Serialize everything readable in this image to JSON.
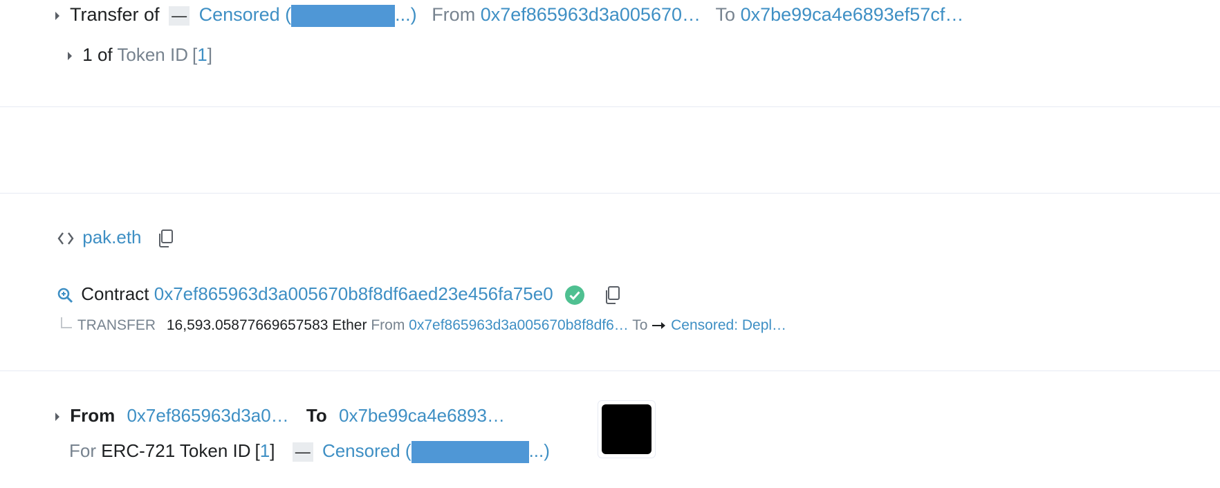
{
  "transfer_row": {
    "prefix": "Transfer of",
    "dash": "—",
    "token_name": "Censored (",
    "token_suffix": "...)",
    "from_label": "From",
    "from_addr": "0x7ef865963d3a005670…",
    "to_label": "To",
    "to_addr": "0x7be99ca4e6893ef57cf…"
  },
  "token_id_row": {
    "count": "1",
    "of_label": "of",
    "token_id_label": "Token ID",
    "bracket_open": "[",
    "token_id": "1",
    "bracket_close": "]"
  },
  "ens": {
    "name": "pak.eth"
  },
  "contract": {
    "label": "Contract",
    "address": "0x7ef865963d3a005670b8f8df6aed23e456fa75e0"
  },
  "internal_transfer": {
    "type": "TRANSFER",
    "amount": "16,593.05877669657583 Ether",
    "from_label": "From",
    "from_addr": "0x7ef865963d3a005670b8f8df6…",
    "to_label": "To",
    "to_addr": "Censored: Depl…"
  },
  "nft_transfer": {
    "from_label": "From",
    "from_addr": "0x7ef865963d3a0…",
    "to_label": "To",
    "to_addr": "0x7be99ca4e6893…",
    "for_label": "For",
    "standard": "ERC-721 Token ID",
    "bracket_open": "[",
    "token_id": "1",
    "bracket_close": "]",
    "dash": "—",
    "token_name": "Censored (",
    "token_suffix": "...)"
  },
  "colors": {
    "link": "#3e8fc4",
    "muted": "#77838f",
    "text": "#1e2022",
    "censor": "#4f97d6",
    "verified": "#4fc091"
  }
}
